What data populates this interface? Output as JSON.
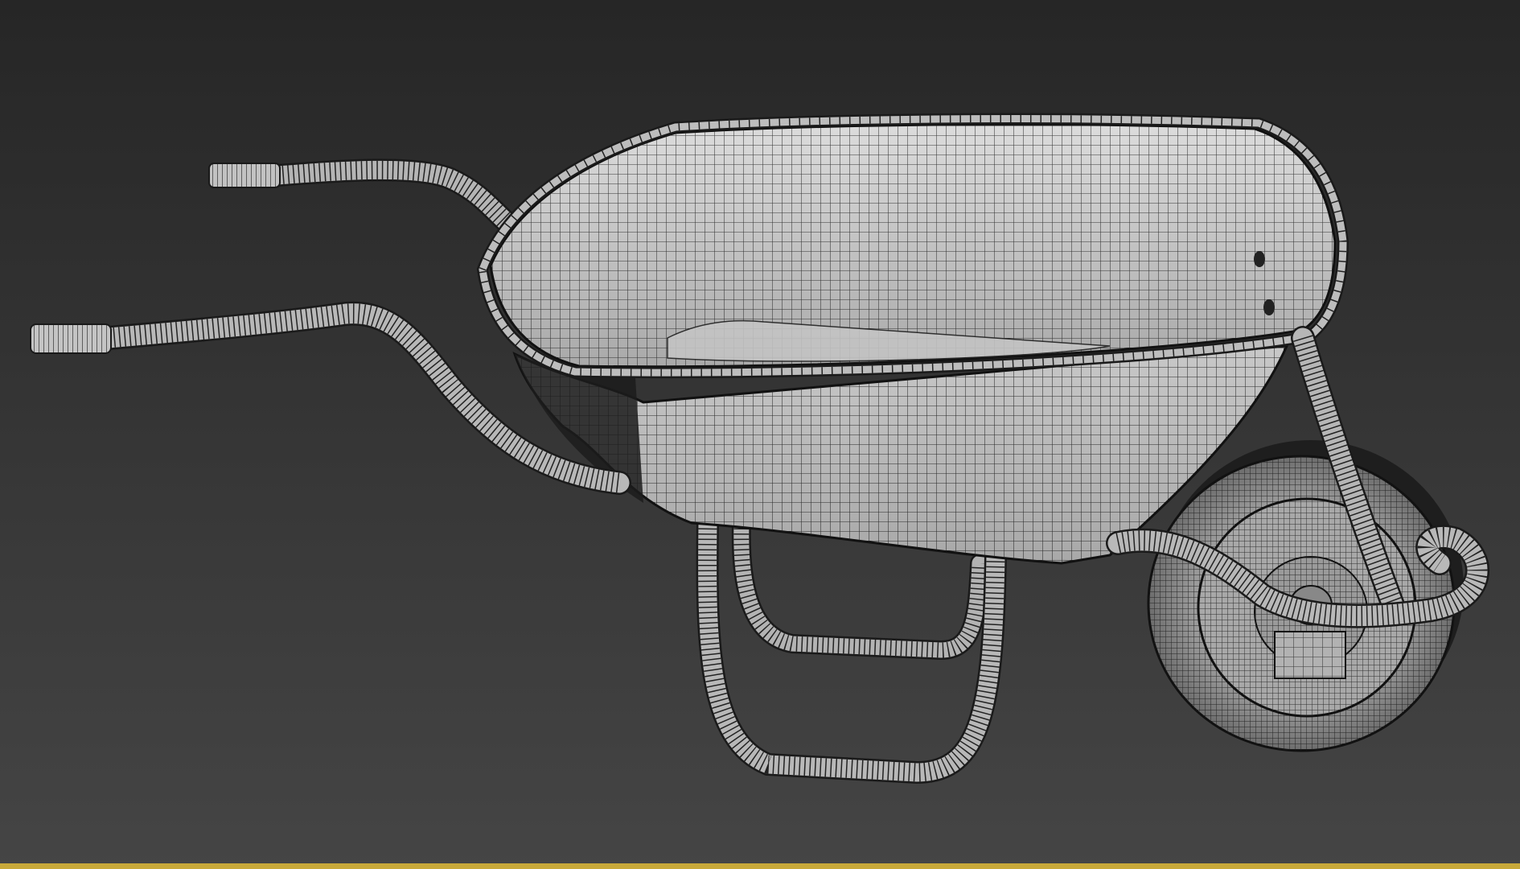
{
  "viewport": {
    "background_top": "#262626",
    "background_bottom": "#454545",
    "active_border_color": "#c8a93a"
  },
  "model": {
    "surface_color": "#b9b9b9",
    "surface_light": "#d9d9d9",
    "surface_dark": "#5e5e5e",
    "wire_color": "#141414",
    "parts": [
      "tray",
      "handle-near",
      "handle-far",
      "leg-front",
      "leg-back",
      "wheel",
      "wheel-hub",
      "axle-fork",
      "front-strut"
    ]
  }
}
